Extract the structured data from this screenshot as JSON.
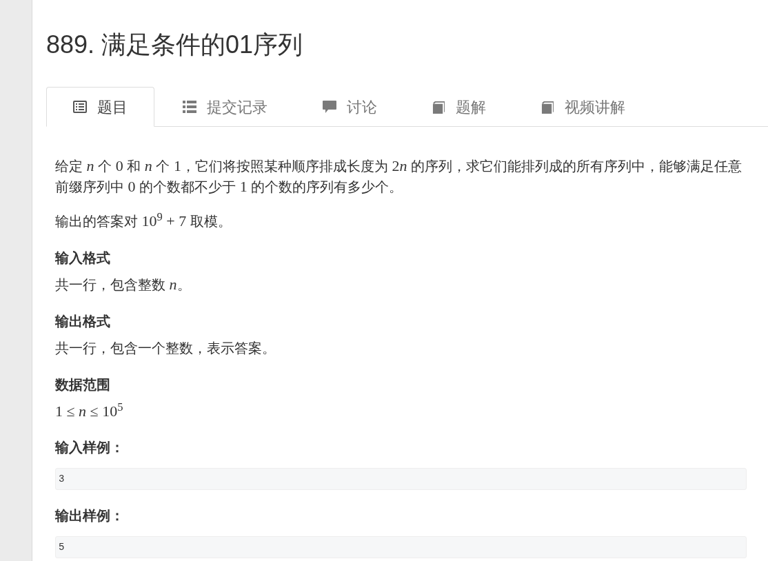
{
  "problem": {
    "title": "889. 满足条件的01序列"
  },
  "tabs": [
    {
      "label": "题目",
      "selected": true
    },
    {
      "label": "提交记录",
      "selected": false
    },
    {
      "label": "讨论",
      "selected": false
    },
    {
      "label": "题解",
      "selected": false
    },
    {
      "label": "视频讲解",
      "selected": false
    }
  ],
  "statement": [
    [
      {
        "kind": "text",
        "text": "给定 "
      },
      {
        "kind": "math",
        "text": "*n*"
      },
      {
        "kind": "text",
        "text": " 个 "
      },
      {
        "kind": "math",
        "text": "0"
      },
      {
        "kind": "text",
        "text": " 和 "
      },
      {
        "kind": "math",
        "text": "*n*"
      },
      {
        "kind": "text",
        "text": " 个 "
      },
      {
        "kind": "math",
        "text": "1"
      },
      {
        "kind": "text",
        "text": "，它们将按照某种顺序排成长度为 "
      },
      {
        "kind": "math",
        "text": "2"
      },
      {
        "kind": "math",
        "text": "*n*"
      },
      {
        "kind": "text",
        "text": " 的序列，求它们能排列成的所有序列中，能够满足任意前缀序列中 "
      },
      {
        "kind": "math",
        "text": "0"
      },
      {
        "kind": "text",
        "text": " 的个数都不少于 "
      },
      {
        "kind": "math",
        "text": "1"
      },
      {
        "kind": "text",
        "text": " 的个数的序列有多少个。"
      }
    ],
    [
      {
        "kind": "text",
        "text": "输出的答案对 "
      },
      {
        "kind": "math",
        "text": "10$^{9}$ + 7"
      },
      {
        "kind": "text",
        "text": " 取模。"
      }
    ]
  ],
  "sections": [
    {
      "kind": "text",
      "heading": "输入格式",
      "body": [
        {
          "kind": "text",
          "text": "共一行，包含整数 "
        },
        {
          "kind": "math",
          "text": "*n*"
        },
        {
          "kind": "text",
          "text": "。"
        }
      ]
    },
    {
      "kind": "text",
      "heading": "输出格式",
      "body": [
        {
          "kind": "text",
          "text": "共一行，包含一个整数，表示答案。"
        }
      ]
    },
    {
      "kind": "text",
      "heading": "数据范围",
      "body": [
        {
          "kind": "math",
          "text": "1 ≤ *n* ≤ 10$^{5}$"
        }
      ]
    },
    {
      "kind": "code",
      "heading": "输入样例：",
      "code": "3"
    },
    {
      "kind": "code",
      "heading": "输出样例：",
      "code": "5"
    }
  ]
}
